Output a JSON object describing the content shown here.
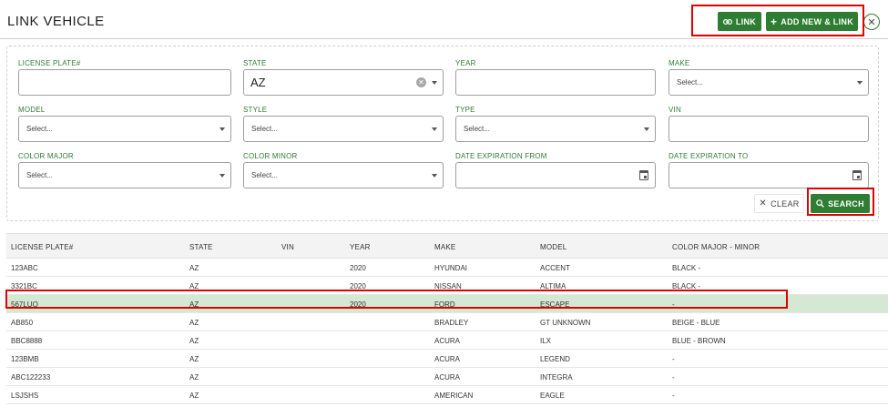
{
  "header": {
    "title": "LINK VEHICLE",
    "link_label": "LINK",
    "add_new_label": "ADD NEW & LINK"
  },
  "filters": {
    "license_plate": {
      "label": "LICENSE PLATE#",
      "value": ""
    },
    "state": {
      "label": "STATE",
      "value": "AZ"
    },
    "year": {
      "label": "YEAR",
      "value": ""
    },
    "make": {
      "label": "MAKE",
      "placeholder": "Select..."
    },
    "model": {
      "label": "MODEL",
      "placeholder": "Select..."
    },
    "style": {
      "label": "STYLE",
      "placeholder": "Select..."
    },
    "type": {
      "label": "TYPE",
      "placeholder": "Select..."
    },
    "vin": {
      "label": "VIN",
      "value": ""
    },
    "color_major": {
      "label": "COLOR MAJOR",
      "placeholder": "Select..."
    },
    "color_minor": {
      "label": "COLOR MINOR",
      "placeholder": "Select..."
    },
    "date_from": {
      "label": "DATE EXPIRATION FROM",
      "value": ""
    },
    "date_to": {
      "label": "DATE EXPIRATION TO",
      "value": ""
    },
    "clear_label": "CLEAR",
    "search_label": "SEARCH"
  },
  "table": {
    "columns": [
      "LICENSE PLATE#",
      "STATE",
      "VIN",
      "YEAR",
      "MAKE",
      "MODEL",
      "COLOR MAJOR - MINOR"
    ],
    "rows": [
      {
        "plate": "123ABC",
        "state": "AZ",
        "vin": "",
        "year": "2020",
        "make": "HYUNDAI",
        "model": "ACCENT",
        "color": "BLACK -",
        "selected": false
      },
      {
        "plate": "3321BC",
        "state": "AZ",
        "vin": "",
        "year": "2020",
        "make": "NISSAN",
        "model": "ALTIMA",
        "color": "BLACK -",
        "selected": false
      },
      {
        "plate": "567LUO",
        "state": "AZ",
        "vin": "",
        "year": "2020",
        "make": "FORD",
        "model": "ESCAPE",
        "color": "-",
        "selected": true
      },
      {
        "plate": "AB850",
        "state": "AZ",
        "vin": "",
        "year": "",
        "make": "BRADLEY",
        "model": "GT UNKNOWN",
        "color": "BEIGE - BLUE",
        "selected": false
      },
      {
        "plate": "BBC8888",
        "state": "AZ",
        "vin": "",
        "year": "",
        "make": "ACURA",
        "model": "ILX",
        "color": "BLUE - BROWN",
        "selected": false
      },
      {
        "plate": "123BMB",
        "state": "AZ",
        "vin": "",
        "year": "",
        "make": "ACURA",
        "model": "LEGEND",
        "color": "-",
        "selected": false
      },
      {
        "plate": "ABC122233",
        "state": "AZ",
        "vin": "",
        "year": "",
        "make": "ACURA",
        "model": "INTEGRA",
        "color": "-",
        "selected": false
      },
      {
        "plate": "LSJSHS",
        "state": "AZ",
        "vin": "",
        "year": "",
        "make": "AMERICAN",
        "model": "EAGLE",
        "color": "-",
        "selected": false
      }
    ]
  },
  "colors": {
    "accent": "#2e7d32",
    "selected_row": "#d4e8d3",
    "highlight": "#e00000"
  }
}
